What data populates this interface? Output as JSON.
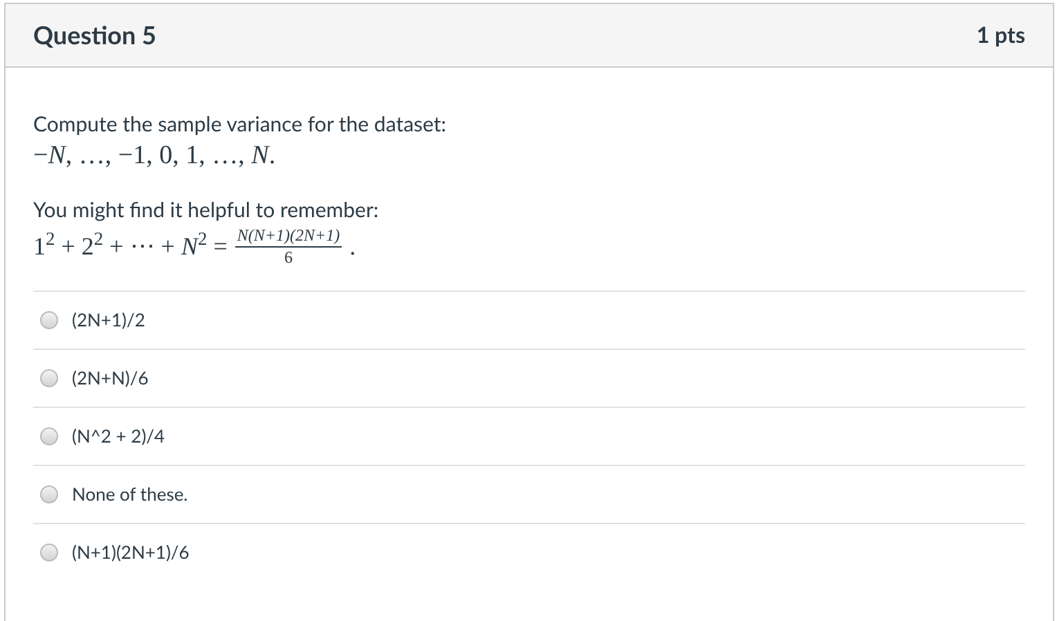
{
  "question": {
    "title": "Question 5",
    "points": "1 pts"
  },
  "prompt": "Compute the sample variance for the dataset:",
  "dataset": "−*N*, …, −1, 0, 1, …, *N*.",
  "hint": "You might find it helpful to remember:",
  "formula": {
    "left": "1$^{2}$ + 2$^{2}$ + ⋯ + *N*$^{2}$ =",
    "numerator": "N(N+1)(2N+1)",
    "denominator": "6",
    "end": "."
  },
  "answers": [
    {
      "label": "(2N+1)/2",
      "selected": false
    },
    {
      "label": "(2N+N)/6",
      "selected": false
    },
    {
      "label": "(N^2 + 2)/4",
      "selected": false
    },
    {
      "label": "None of these.",
      "selected": false
    },
    {
      "label": "(N+1)(2N+1)/6",
      "selected": false
    }
  ]
}
